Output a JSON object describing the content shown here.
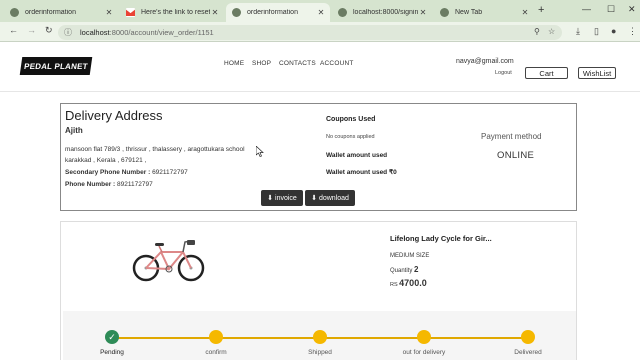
{
  "browser": {
    "tabs": [
      {
        "label": "orderinformation",
        "active": false
      },
      {
        "label": "Here's the link to reset y",
        "active": false
      },
      {
        "label": "orderinformation",
        "active": true
      },
      {
        "label": "localhost:8000/signin",
        "active": false
      },
      {
        "label": "New Tab",
        "active": false
      }
    ],
    "new_tab": "+",
    "url_host": "localhost",
    "url_path": ":8000/account/view_order/1151"
  },
  "header": {
    "logo": "PEDAL PLANET",
    "nav": [
      "HOME",
      "SHOP",
      "CONTACTS",
      "ACCOUNT"
    ],
    "email": "navya@gmail.com",
    "logout": "Logout",
    "cart": "Cart",
    "wishlist": "WishList"
  },
  "delivery": {
    "title": "Delivery Address",
    "name": "Ajith",
    "address": "mansoon flat 789/3 , thrissur , thalassery , aragottukara school karakkad , Kerala , 679121 ,",
    "secondary_label": "Secondary Phone Number :",
    "secondary_value": "6921172797",
    "phone_label": "Phone Number :",
    "phone_value": "8921172797",
    "coupons_heading": "Coupons Used",
    "coupons_value": "No coupons applied",
    "wallet_used_label": "Wallet amount used",
    "wallet_used2_label": "Wallet amount used ₹0",
    "payment_heading": "Payment method",
    "payment_value": "ONLINE",
    "invoice_label": "invoice",
    "download_label": "download"
  },
  "product": {
    "name": "Lifelong Lady Cycle for Gir...",
    "size": "MEDIUM SIZE",
    "qty_label": "Quantity",
    "qty_value": "2",
    "price_label": "RS",
    "price_value": "4700.0"
  },
  "tracker": {
    "steps": [
      {
        "label": "Pending",
        "done": true
      },
      {
        "label": "confirm",
        "done": false
      },
      {
        "label": "Shipped",
        "done": false
      },
      {
        "label": "out for delivery",
        "done": false
      },
      {
        "label": "Delivered",
        "done": false
      }
    ]
  },
  "colors": {
    "tab_strip": "#d6e4cf",
    "step_pending": "#f5b800",
    "step_done": "#2e8b57",
    "dark_button": "#333333"
  }
}
